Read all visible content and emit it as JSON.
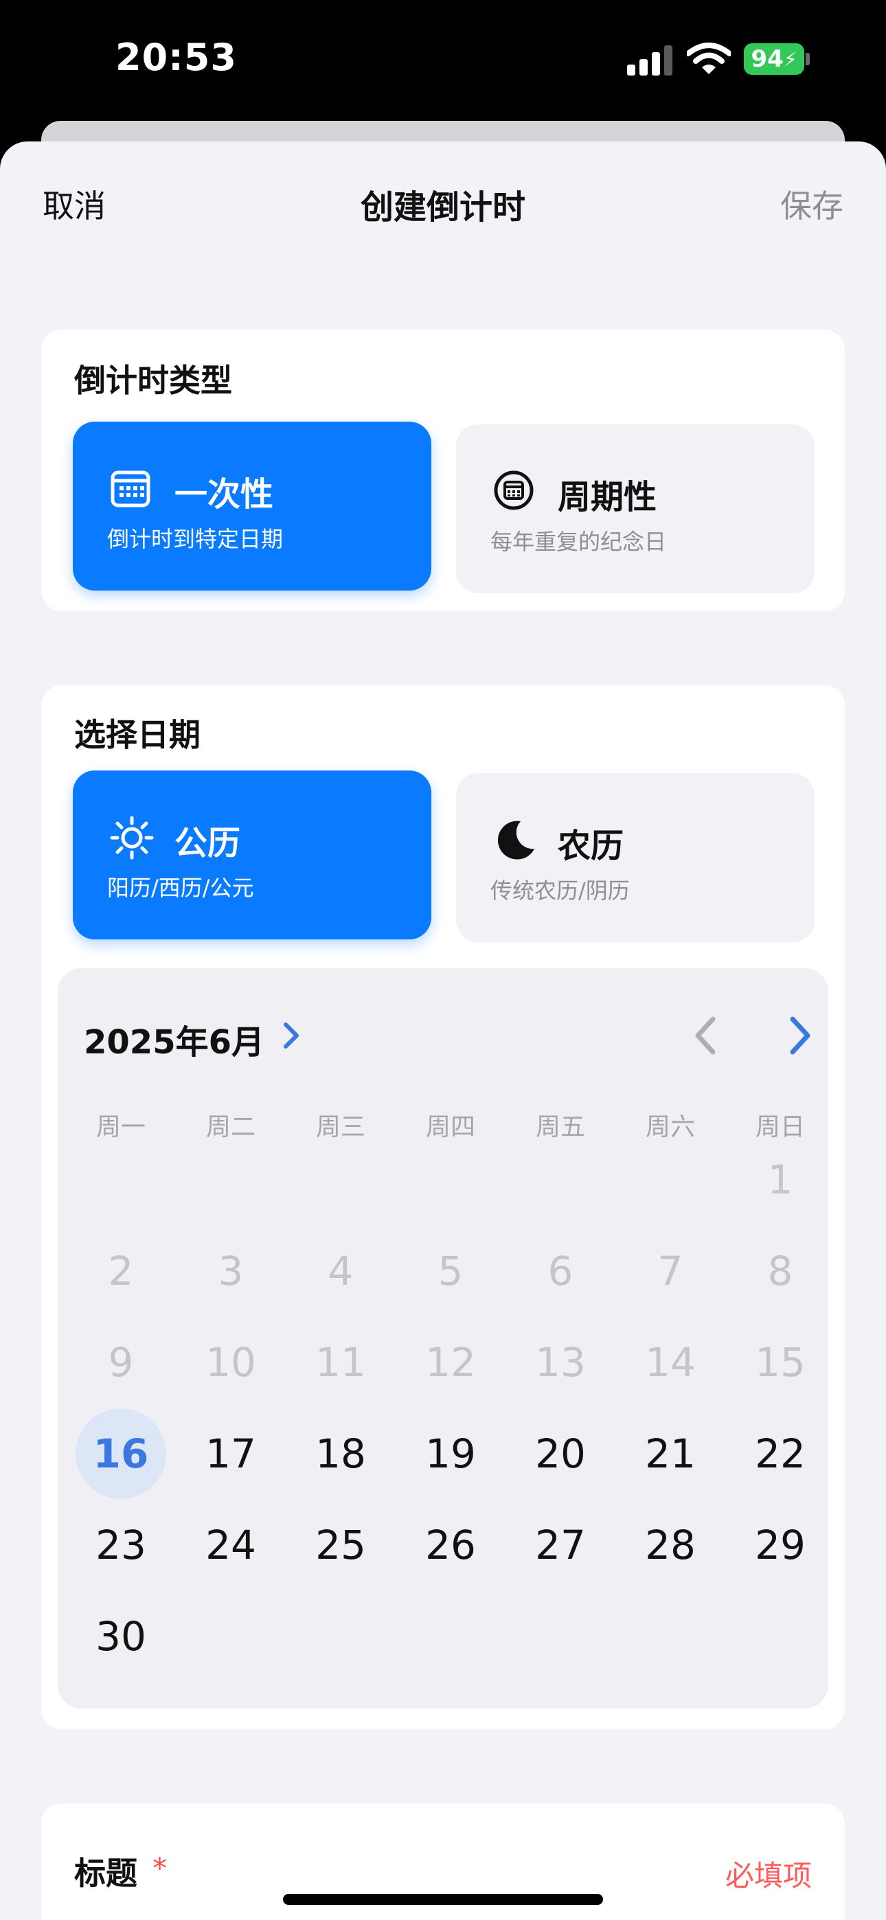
{
  "status_bar": {
    "time": "20:53",
    "battery": "94"
  },
  "nav": {
    "cancel": "取消",
    "title": "创建倒计时",
    "save": "保存"
  },
  "countdown_type": {
    "label": "倒计时类型",
    "options": [
      {
        "name": "一次性",
        "description": "倒计时到特定日期",
        "icon": "calendar-icon",
        "selected": true
      },
      {
        "name": "周期性",
        "description": "每年重复的纪念日",
        "icon": "recurring-calendar-icon",
        "selected": false
      }
    ]
  },
  "date_select": {
    "label": "选择日期",
    "options": [
      {
        "name": "公历",
        "description": "阳历/西历/公元",
        "icon": "sun-icon",
        "selected": true
      },
      {
        "name": "农历",
        "description": "传统农历/阴历",
        "icon": "moon-icon",
        "selected": false
      }
    ]
  },
  "calendar": {
    "month_label": "2025年6月",
    "weekdays": [
      "周一",
      "周二",
      "周三",
      "周四",
      "周五",
      "周六",
      "周日"
    ],
    "first_day_column": 6,
    "days_in_month": 30,
    "today": 16
  },
  "title_field": {
    "label": "标题",
    "required_mark": "*",
    "hint": "必填项"
  },
  "colors": {
    "accent": "#0a7aff",
    "required": "#ff5b5b",
    "today_bg": "#dde6f6"
  }
}
